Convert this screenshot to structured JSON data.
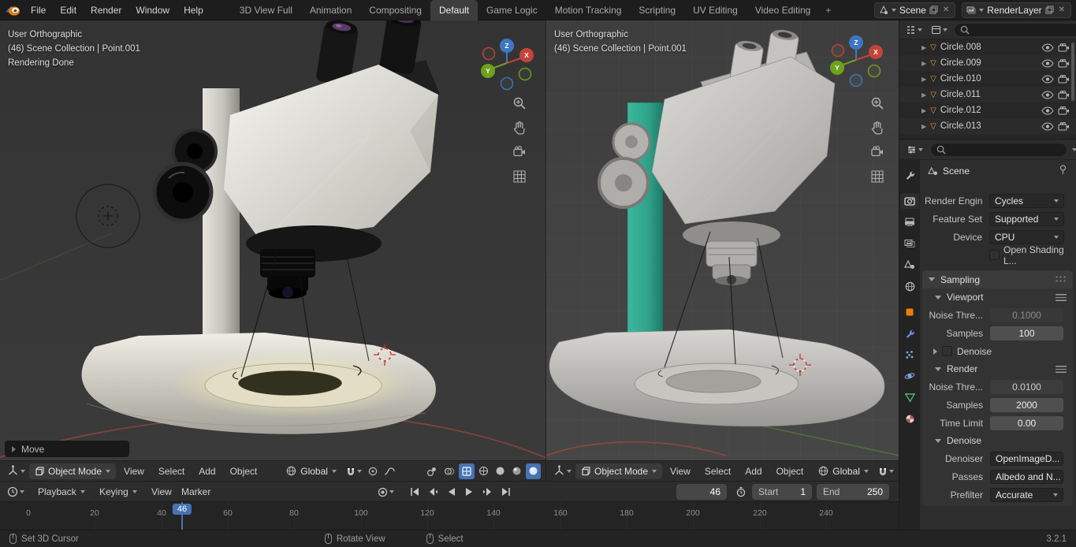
{
  "topbar": {
    "menus": [
      "File",
      "Edit",
      "Render",
      "Window",
      "Help"
    ],
    "workspaces": [
      "3D View Full",
      "Animation",
      "Compositing",
      "Default",
      "Game Logic",
      "Motion Tracking",
      "Scripting",
      "UV Editing",
      "Video Editing"
    ],
    "active_workspace": "Default",
    "add_tab": "+",
    "scene_field": "Scene",
    "renderlayer_field": "RenderLayer"
  },
  "viewport_left": {
    "view_label": "User Orthographic",
    "collection_label": "(46) Scene Collection | Point.001",
    "status_label": "Rendering Done",
    "operator_label": "Move",
    "mode": "Object Mode",
    "menus": [
      "View",
      "Select",
      "Add",
      "Object"
    ],
    "orientation": "Global"
  },
  "viewport_right": {
    "view_label": "User Orthographic",
    "collection_label": "(46) Scene Collection | Point.001",
    "mode": "Object Mode",
    "menus": [
      "View",
      "Select",
      "Add",
      "Object"
    ],
    "orientation": "Global"
  },
  "gizmo": {
    "x": "X",
    "y": "Y",
    "z": "Z"
  },
  "outliner": {
    "items": [
      "Circle.008",
      "Circle.009",
      "Circle.010",
      "Circle.011",
      "Circle.012",
      "Circle.013"
    ]
  },
  "properties": {
    "breadcrumb": "Scene",
    "render_engine_label": "Render Engin",
    "render_engine_value": "Cycles",
    "feature_set_label": "Feature Set",
    "feature_set_value": "Supported",
    "device_label": "Device",
    "device_value": "CPU",
    "osl_label": "Open Shading L...",
    "sampling_title": "Sampling",
    "viewport_title": "Viewport",
    "vp_noise_label": "Noise Thre...",
    "vp_noise_value": "0.1000",
    "vp_samples_label": "Samples",
    "vp_samples_value": "100",
    "vp_denoise_label": "Denoise",
    "render_title": "Render",
    "r_noise_label": "Noise Thre...",
    "r_noise_value": "0.0100",
    "r_samples_label": "Samples",
    "r_samples_value": "2000",
    "time_limit_label": "Time Limit",
    "time_limit_value": "0.00",
    "denoise_title": "Denoise",
    "denoiser_label": "Denoiser",
    "denoiser_value": "OpenImageD...",
    "passes_label": "Passes",
    "passes_value": "Albedo and N...",
    "prefilter_label": "Prefilter",
    "prefilter_value": "Accurate"
  },
  "timeline": {
    "playback": "Playback",
    "keying": "Keying",
    "menu_view": "View",
    "menu_marker": "Marker",
    "current_frame": "46",
    "start_label": "Start",
    "start_value": "1",
    "end_label": "End",
    "end_value": "250",
    "ticks": [
      "0",
      "20",
      "40",
      "60",
      "80",
      "100",
      "120",
      "140",
      "160",
      "180",
      "200",
      "220",
      "240"
    ]
  },
  "statusbar": {
    "hint_set_cursor": "Set 3D Cursor",
    "hint_rotate": "Rotate View",
    "hint_select": "Select",
    "version": "3.2.1"
  },
  "colors": {
    "accent_blue": "#4772b3",
    "axis_x_red": "#c5443a",
    "axis_y_green": "#6fa21c",
    "axis_z_blue": "#3f76c4",
    "column_teal": "#2fa189",
    "mesh_icon_orange": "#e9963e"
  }
}
